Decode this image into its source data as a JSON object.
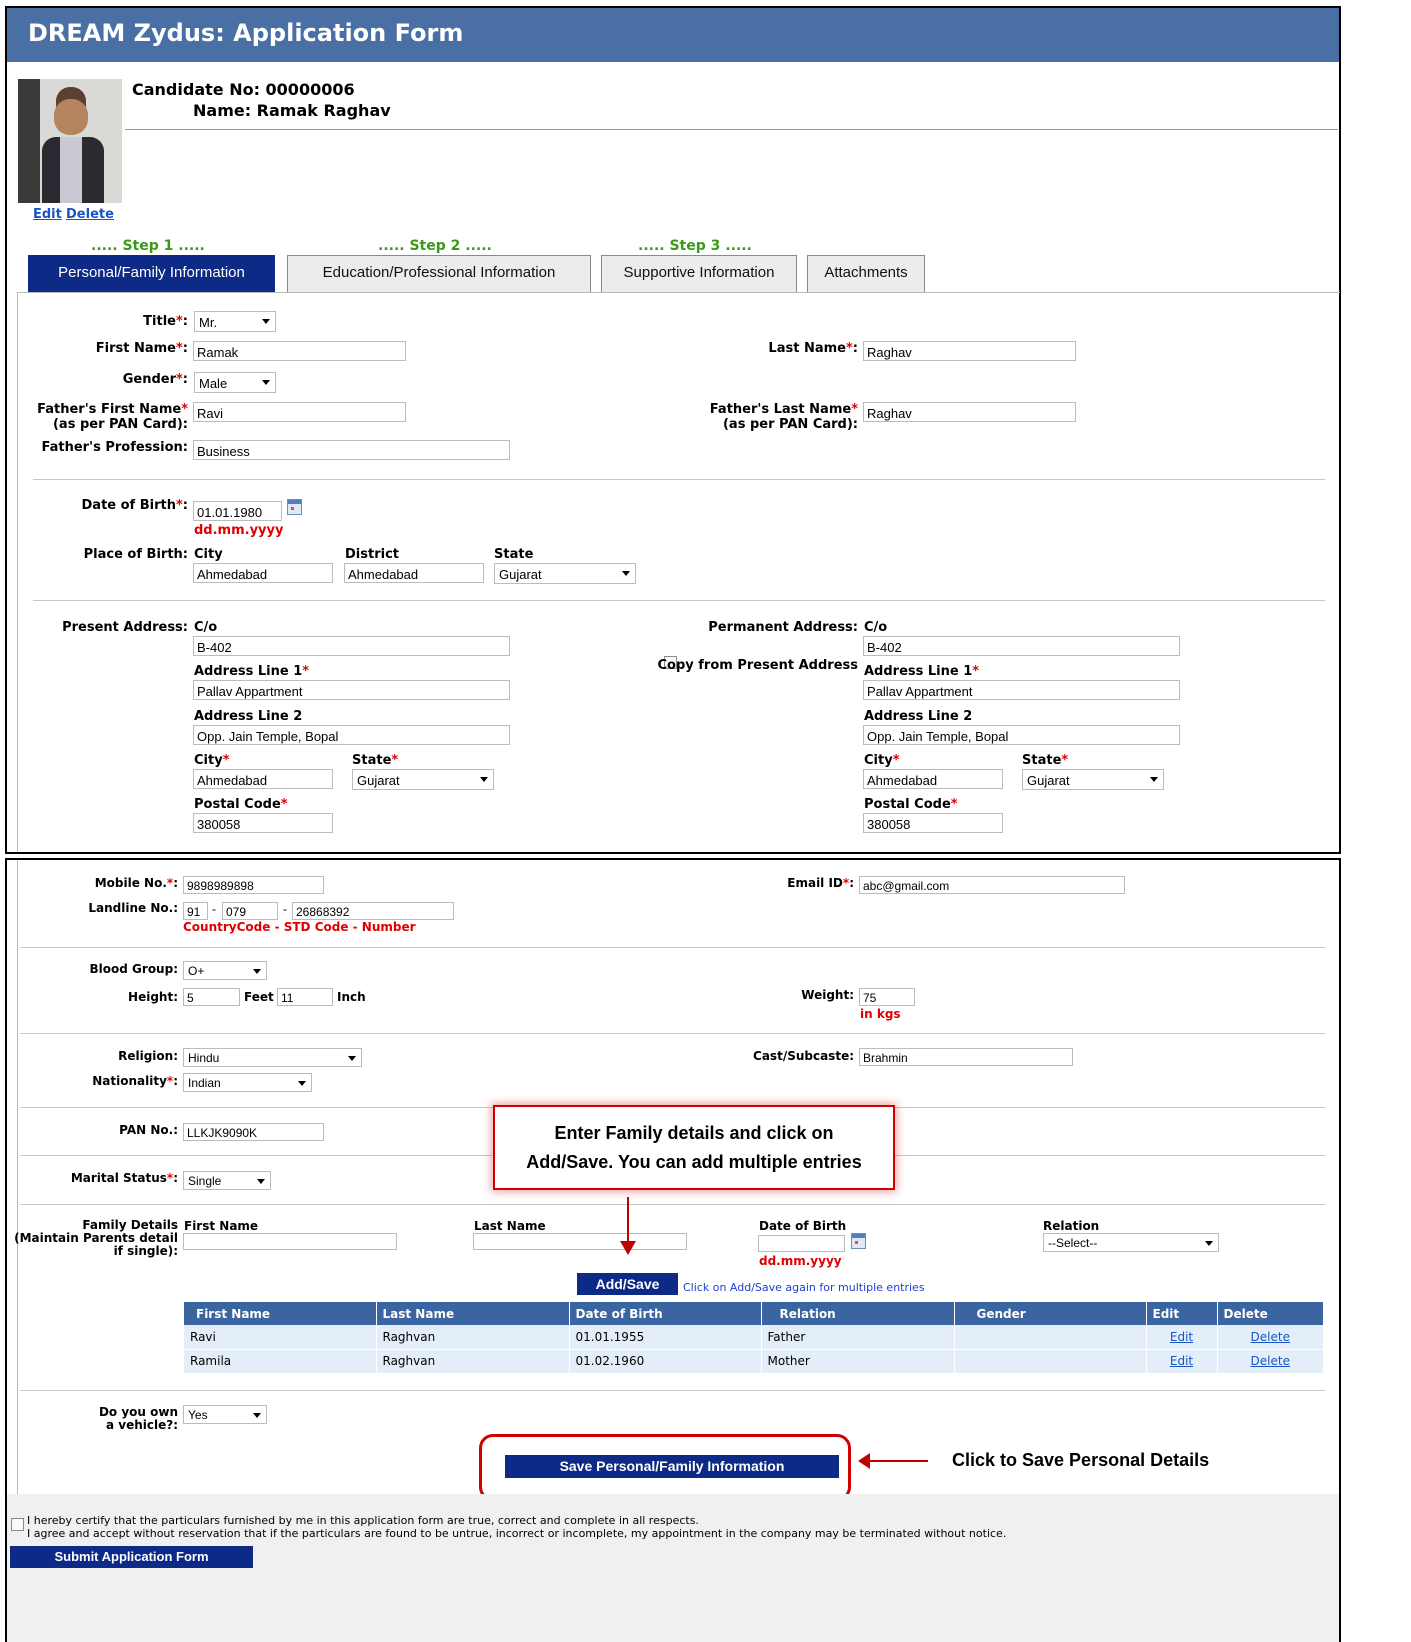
{
  "header": {
    "title": "DREAM Zydus: Application Form"
  },
  "candidate": {
    "no_label": "Candidate No: 00000006",
    "name_label": "Name: Ramak Raghav",
    "edit_link": "Edit",
    "delete_link": "Delete"
  },
  "steps": [
    "..... Step 1 .....",
    "..... Step 2 .....",
    "..... Step 3 ....."
  ],
  "tabs": [
    "Personal/Family Information",
    "Education/Professional Information",
    "Supportive Information",
    "Attachments"
  ],
  "personal": {
    "title_label": "Title",
    "title_value": "Mr.",
    "first_name_label": "First Name",
    "first_name_value": "Ramak",
    "last_name_label": "Last Name",
    "last_name_value": "Raghav",
    "gender_label": "Gender",
    "gender_value": "Male",
    "father_first_label_1": "Father's First Name",
    "father_first_label_2": "(as per PAN Card):",
    "father_first_value": "Ravi",
    "father_last_label_1": "Father's Last Name",
    "father_last_label_2": "(as per PAN Card):",
    "father_last_value": "Raghav",
    "father_prof_label": "Father's Profession:",
    "father_prof_value": "Business",
    "dob_label": "Date of Birth",
    "dob_value": "01.01.1980",
    "dob_hint": "dd.mm.yyyy",
    "pob_label": "Place of Birth:",
    "pob_city_label": "City",
    "pob_city_value": "Ahmedabad",
    "pob_district_label": "District",
    "pob_district_value": "Ahmedabad",
    "pob_state_label": "State",
    "pob_state_value": "Gujarat"
  },
  "address": {
    "present_label": "Present Address:",
    "permanent_label": "Permanent Address:",
    "co_label": "C/o",
    "line1_label": "Address Line 1",
    "line2_label": "Address Line 2",
    "city_label": "City",
    "state_label": "State",
    "postal_label": "Postal Code",
    "copy_label": "Copy from Present Address",
    "present": {
      "co": "B-402",
      "line1": "Pallav Appartment",
      "line2": "Opp. Jain Temple, Bopal",
      "city": "Ahmedabad",
      "state": "Gujarat",
      "postal": "380058"
    },
    "permanent": {
      "co": "B-402",
      "line1": "Pallav Appartment",
      "line2": "Opp. Jain Temple, Bopal",
      "city": "Ahmedabad",
      "state": "Gujarat",
      "postal": "380058"
    }
  },
  "contact": {
    "mobile_label": "Mobile No.",
    "mobile_value": "9898989898",
    "email_label": "Email ID",
    "email_value": "abc@gmail.com",
    "landline_label": "Landline No.:",
    "landline_cc": "91",
    "landline_std": "079",
    "landline_num": "26868392",
    "sep": "-",
    "landline_hint": "CountryCode - STD Code - Number"
  },
  "physical": {
    "blood_label": "Blood Group:",
    "blood_value": "O+",
    "height_label": "Height:",
    "height_ft": "5",
    "feet_label": "Feet",
    "height_in": "11",
    "inch_label": "Inch",
    "weight_label": "Weight:",
    "weight_value": "75",
    "weight_hint": "in kgs"
  },
  "other": {
    "religion_label": "Religion:",
    "religion_value": "Hindu",
    "cast_label": "Cast/Subcaste:",
    "cast_value": "Brahmin",
    "nationality_label": "Nationality",
    "nationality_value": "Indian",
    "pan_label": "PAN No.:",
    "pan_value": "LLKJK9090K",
    "marital_label": "Marital Status",
    "marital_value": "Single"
  },
  "family": {
    "label_1": "Family Details",
    "label_2": "(Maintain Parents detail",
    "label_3": "if single):",
    "first_label": "First Name",
    "last_label": "Last Name",
    "dob_label": "Date of Birth",
    "relation_label": "Relation",
    "relation_value": "--Select--",
    "dob_hint": "dd.mm.yyyy",
    "add_button": "Add/Save",
    "add_hint": "Click on Add/Save again for multiple entries",
    "columns": [
      "First Name",
      "Last Name",
      "Date of Birth",
      "Relation",
      "Gender",
      "Edit",
      "Delete"
    ],
    "rows": [
      {
        "first": "Ravi",
        "last": "Raghvan",
        "dob": "01.01.1955",
        "relation": "Father",
        "gender": "",
        "edit": "Edit",
        "delete": "Delete"
      },
      {
        "first": "Ramila",
        "last": "Raghvan",
        "dob": "01.02.1960",
        "relation": "Mother",
        "gender": "",
        "edit": "Edit",
        "delete": "Delete"
      }
    ]
  },
  "vehicle": {
    "label_1": "Do you own",
    "label_2": "a vehicle?:",
    "value": "Yes"
  },
  "save_button": "Save Personal/Family Information",
  "callouts": {
    "family_1": "Enter Family details and click on",
    "family_2": "Add/Save. You can add multiple entries",
    "save": "Click to Save Personal Details"
  },
  "certify": {
    "line1": "I hereby certify that the particulars furnished by me in this application form are true, correct and complete in all respects.",
    "line2": "I agree and accept without reservation that if the particulars are found to be untrue, incorrect or incomplete, my appointment in the company may be terminated without notice."
  },
  "submit_button": "Submit Application Form",
  "colors": {
    "header_bg": "#4a6fa5",
    "active_tab": "#0c2a86",
    "required": "#e00000",
    "step": "#3a9a18",
    "callout": "#c00000"
  }
}
